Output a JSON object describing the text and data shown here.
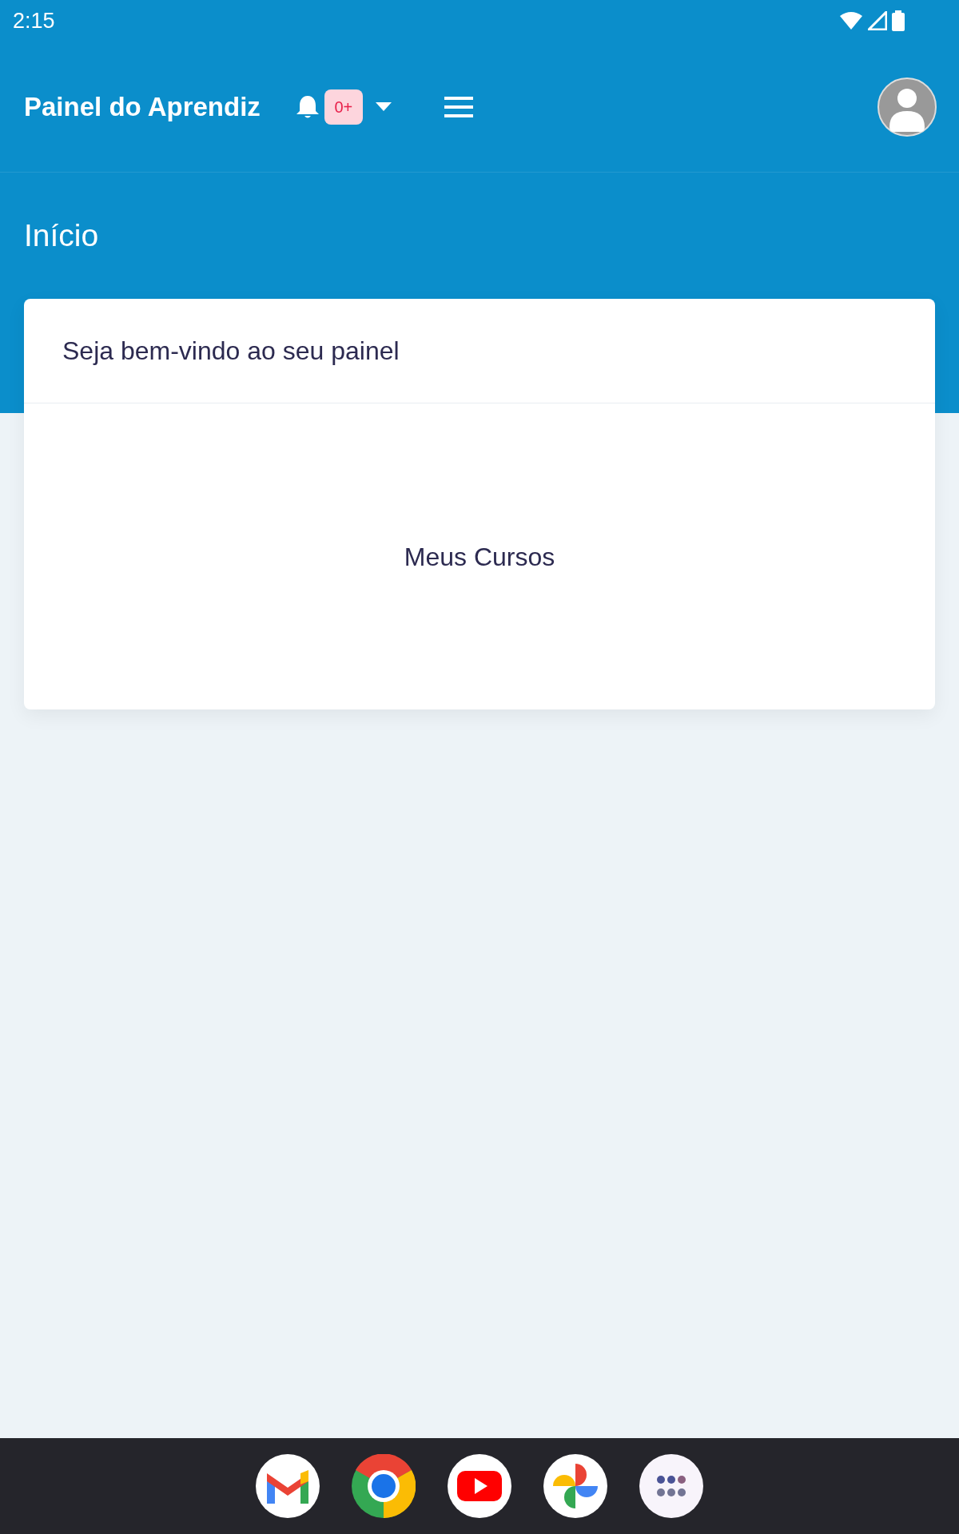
{
  "status_bar": {
    "time": "2:15"
  },
  "header": {
    "title": "Painel do Aprendiz",
    "notifications": {
      "badge": "0+"
    }
  },
  "page_title": "Início",
  "card": {
    "title": "Seja bem-vindo ao seu painel",
    "link": "Meus Cursos"
  }
}
